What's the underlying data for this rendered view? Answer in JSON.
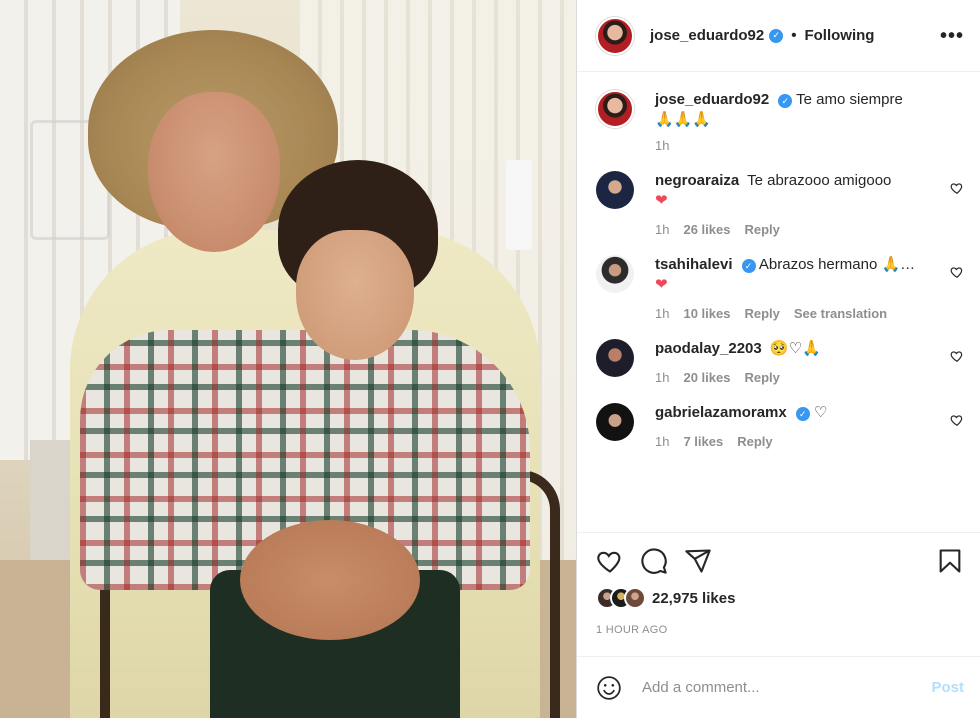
{
  "header": {
    "username": "jose_eduardo92",
    "separator": "•",
    "follow_status": "Following",
    "more": "•••"
  },
  "caption": {
    "username": "jose_eduardo92",
    "text": "Te amo siempre",
    "emojis": "🙏🙏🙏",
    "time": "1h"
  },
  "comments": [
    {
      "username": "negroaraiza",
      "verified": false,
      "text": "Te abrazooo amigooo",
      "extra": "❤",
      "time": "1h",
      "likes": "26 likes",
      "reply": "Reply"
    },
    {
      "username": "tsahihalevi",
      "verified": true,
      "text": "Abrazos hermano 🙏…",
      "extra": "❤",
      "time": "1h",
      "likes": "10 likes",
      "reply": "Reply",
      "translation": "See translation"
    },
    {
      "username": "paodalay_2203",
      "verified": false,
      "text": "🥺♡🙏",
      "extra": "",
      "time": "1h",
      "likes": "20 likes",
      "reply": "Reply"
    },
    {
      "username": "gabrielazamoramx",
      "verified": true,
      "text": "♡",
      "extra": "",
      "time": "1h",
      "likes": "7 likes",
      "reply": "Reply"
    }
  ],
  "stats": {
    "likes": "22,975 likes",
    "time_ago": "1 HOUR AGO"
  },
  "add_comment": {
    "placeholder": "Add a comment...",
    "post_label": "Post"
  },
  "icons": {
    "verified": "verified-badge-icon",
    "like": "heart-icon",
    "comment": "comment-bubble-icon",
    "share": "paper-plane-icon",
    "save": "bookmark-icon",
    "emoji": "smiley-icon"
  },
  "colors": {
    "verified_blue": "#3897f0",
    "heart_red": "#ed4956",
    "post_disabled": "#b2dffc",
    "muted_text": "#8e8e8e"
  }
}
